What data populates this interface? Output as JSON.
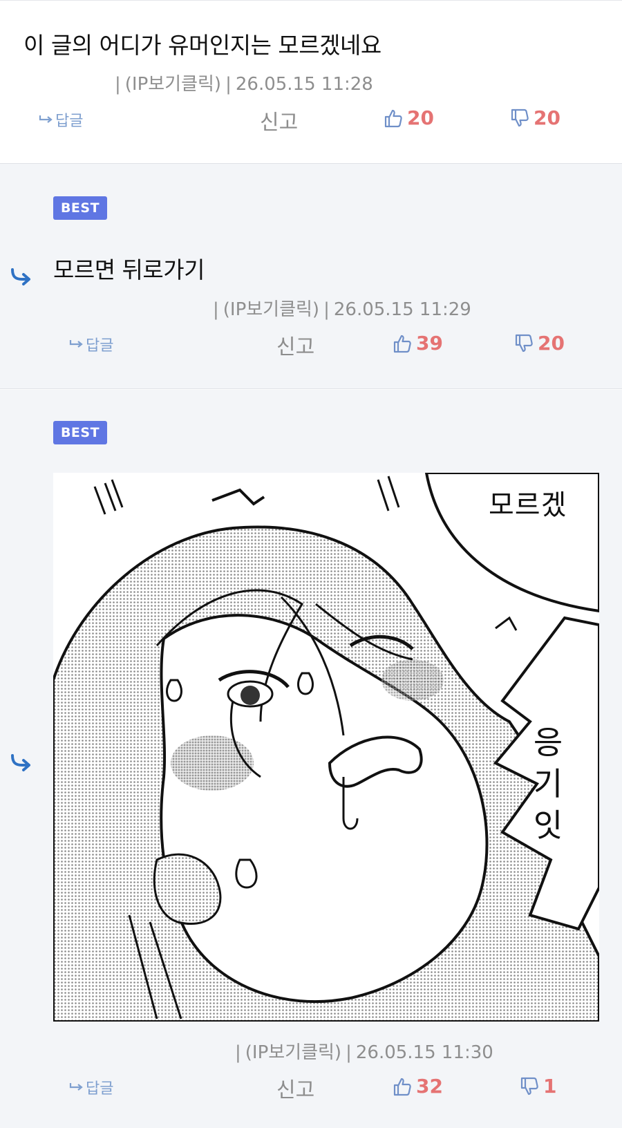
{
  "comments": [
    {
      "text": "이 글의 어디가 유머인지는 모르겠네요",
      "ip_label": "(IP보기클릭)",
      "timestamp": "26.05.15 11:28",
      "reply_label": "답글",
      "report_label": "신고",
      "likes": "20",
      "dislikes": "20"
    },
    {
      "badge": "BEST",
      "text": "모르면 뒤로가기",
      "ip_label": "(IP보기클릭)",
      "timestamp": "26.05.15 11:29",
      "reply_label": "답글",
      "report_label": "신고",
      "likes": "39",
      "dislikes": "20"
    },
    {
      "badge": "BEST",
      "image": {
        "speech_top": "모르겠",
        "speech_side": [
          "응",
          "기",
          "잇"
        ]
      },
      "ip_label": "(IP보기클릭)",
      "timestamp": "26.05.15 11:30",
      "reply_label": "답글",
      "report_label": "신고",
      "likes": "32",
      "dislikes": "1"
    }
  ],
  "colors": {
    "badge": "#5f76e3",
    "reply_link": "#7e9fcf",
    "vote_count": "#e57373",
    "thumb_icon": "#6f8fc8",
    "reply_arrow": "#2f72c4",
    "best_background": "#f3f5f8"
  },
  "icons": {
    "reply_arrow": "reply-arrow-icon",
    "reply_link": "reply-small-arrow-icon",
    "like": "thumbs-up-icon",
    "dislike": "thumbs-down-icon"
  }
}
